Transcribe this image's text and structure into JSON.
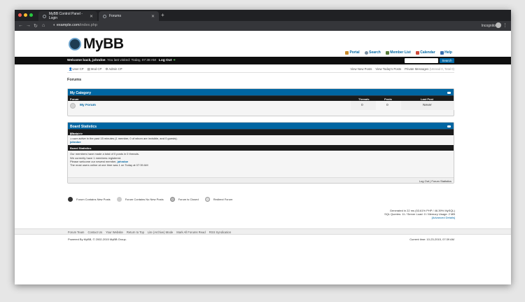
{
  "browser": {
    "tabs": [
      {
        "title": "MyBB Control Panel - Login"
      },
      {
        "title": "Forums"
      }
    ],
    "url_domain": "example.com",
    "url_path": "/index.php",
    "incognito_label": "Incognito"
  },
  "site": {
    "logo_text": "MyBB",
    "topnav": [
      {
        "label": "Portal",
        "icon": "portal-icon"
      },
      {
        "label": "Search",
        "icon": "search-icon"
      },
      {
        "label": "Member List",
        "icon": "members-icon"
      },
      {
        "label": "Calendar",
        "icon": "calendar-icon"
      },
      {
        "label": "Help",
        "icon": "help-icon"
      }
    ]
  },
  "welcome": {
    "prefix": "Welcome back, ",
    "user": "johndoe",
    "last_visit": ". You last visited: Today, 07:38 AM",
    "logout": "Log Out",
    "search_button": "Search"
  },
  "subnav": {
    "left": [
      "User CP",
      "Mod CP",
      "Admin CP"
    ],
    "right": [
      "View New Posts",
      "View Today's Posts",
      "Private Messages"
    ],
    "pm_counts": "(Unread 0, Total 0)"
  },
  "forums_heading": "Forums",
  "category": {
    "title": "My Category",
    "col_forum": "Forum",
    "col_threads": "Threads",
    "col_posts": "Posts",
    "col_last": "Last Post",
    "rows": [
      {
        "name": "My Forum",
        "threads": "0",
        "posts": "0",
        "last": "Never"
      }
    ]
  },
  "stats": {
    "title": "Board Statistics",
    "online_title": "Who's Online",
    "online_link": "[Complete List]",
    "online_text": "1 user active in the past 15 minutes (1 member, 0 of whom are invisible, and 0 guests).",
    "online_user": "johndoe",
    "board_title": "Board Statistics",
    "line1": "Our members have made a total of 0 posts in 0 threads.",
    "line2": "We currently have 1 members registered.",
    "line3_prefix": "Please welcome our newest member, ",
    "newest": "johndoe",
    "line4": "The most users online at one time was 1 on Today at 07:39 AM",
    "footer": "Log Out | Forum Statistics"
  },
  "legend": [
    "Forum Contains New Posts",
    "Forum Contains No New Posts",
    "Forum is Closed",
    "Redirect Forum"
  ],
  "generated": {
    "line1": "Generated in 22 ms (53.61% PHP / 46.39% MySQL)",
    "line2": "SQL Queries: 11 / Server Load: 0 / Memory Usage: 2 MB",
    "line3": "[Advanced Details]"
  },
  "footer_links": [
    "Forum Team",
    "Contact Us",
    "Your Website",
    "Return to Top",
    "Lite (Archive) Mode",
    "Mark All Forums Read",
    "RSS Syndication"
  ],
  "powered": "Powered By MyBB, © 2002-2015 MyBB Group.",
  "current_time": "Current time: 10-23-2015, 07:39 AM",
  "colors": {
    "accent": "#0066a2",
    "dark": "#0f0f0f"
  }
}
